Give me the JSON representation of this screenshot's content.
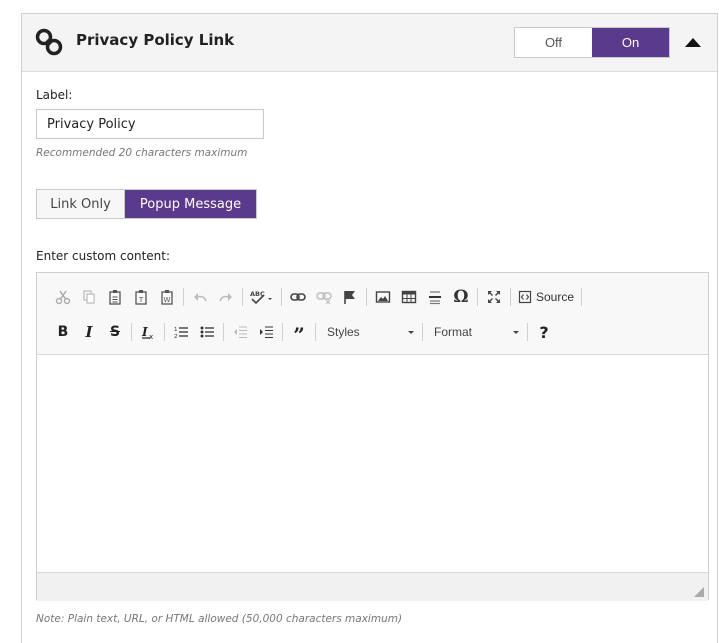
{
  "panel": {
    "title": "Privacy Policy Link",
    "icon": "link-icon",
    "toggle": {
      "off_label": "Off",
      "on_label": "On",
      "selected": "On"
    },
    "accent_color": "#5a3a8c"
  },
  "label_field": {
    "label": "Label:",
    "value": "Privacy Policy",
    "hint": "Recommended 20 characters maximum"
  },
  "mode": {
    "options": [
      "Link Only",
      "Popup Message"
    ],
    "selected": "Popup Message"
  },
  "content": {
    "label": "Enter custom content:",
    "note": "Note: Plain text, URL, or HTML allowed (50,000 characters maximum)",
    "body": ""
  },
  "toolbar": {
    "source_label": "Source",
    "styles_label": "Styles",
    "format_label": "Format"
  }
}
